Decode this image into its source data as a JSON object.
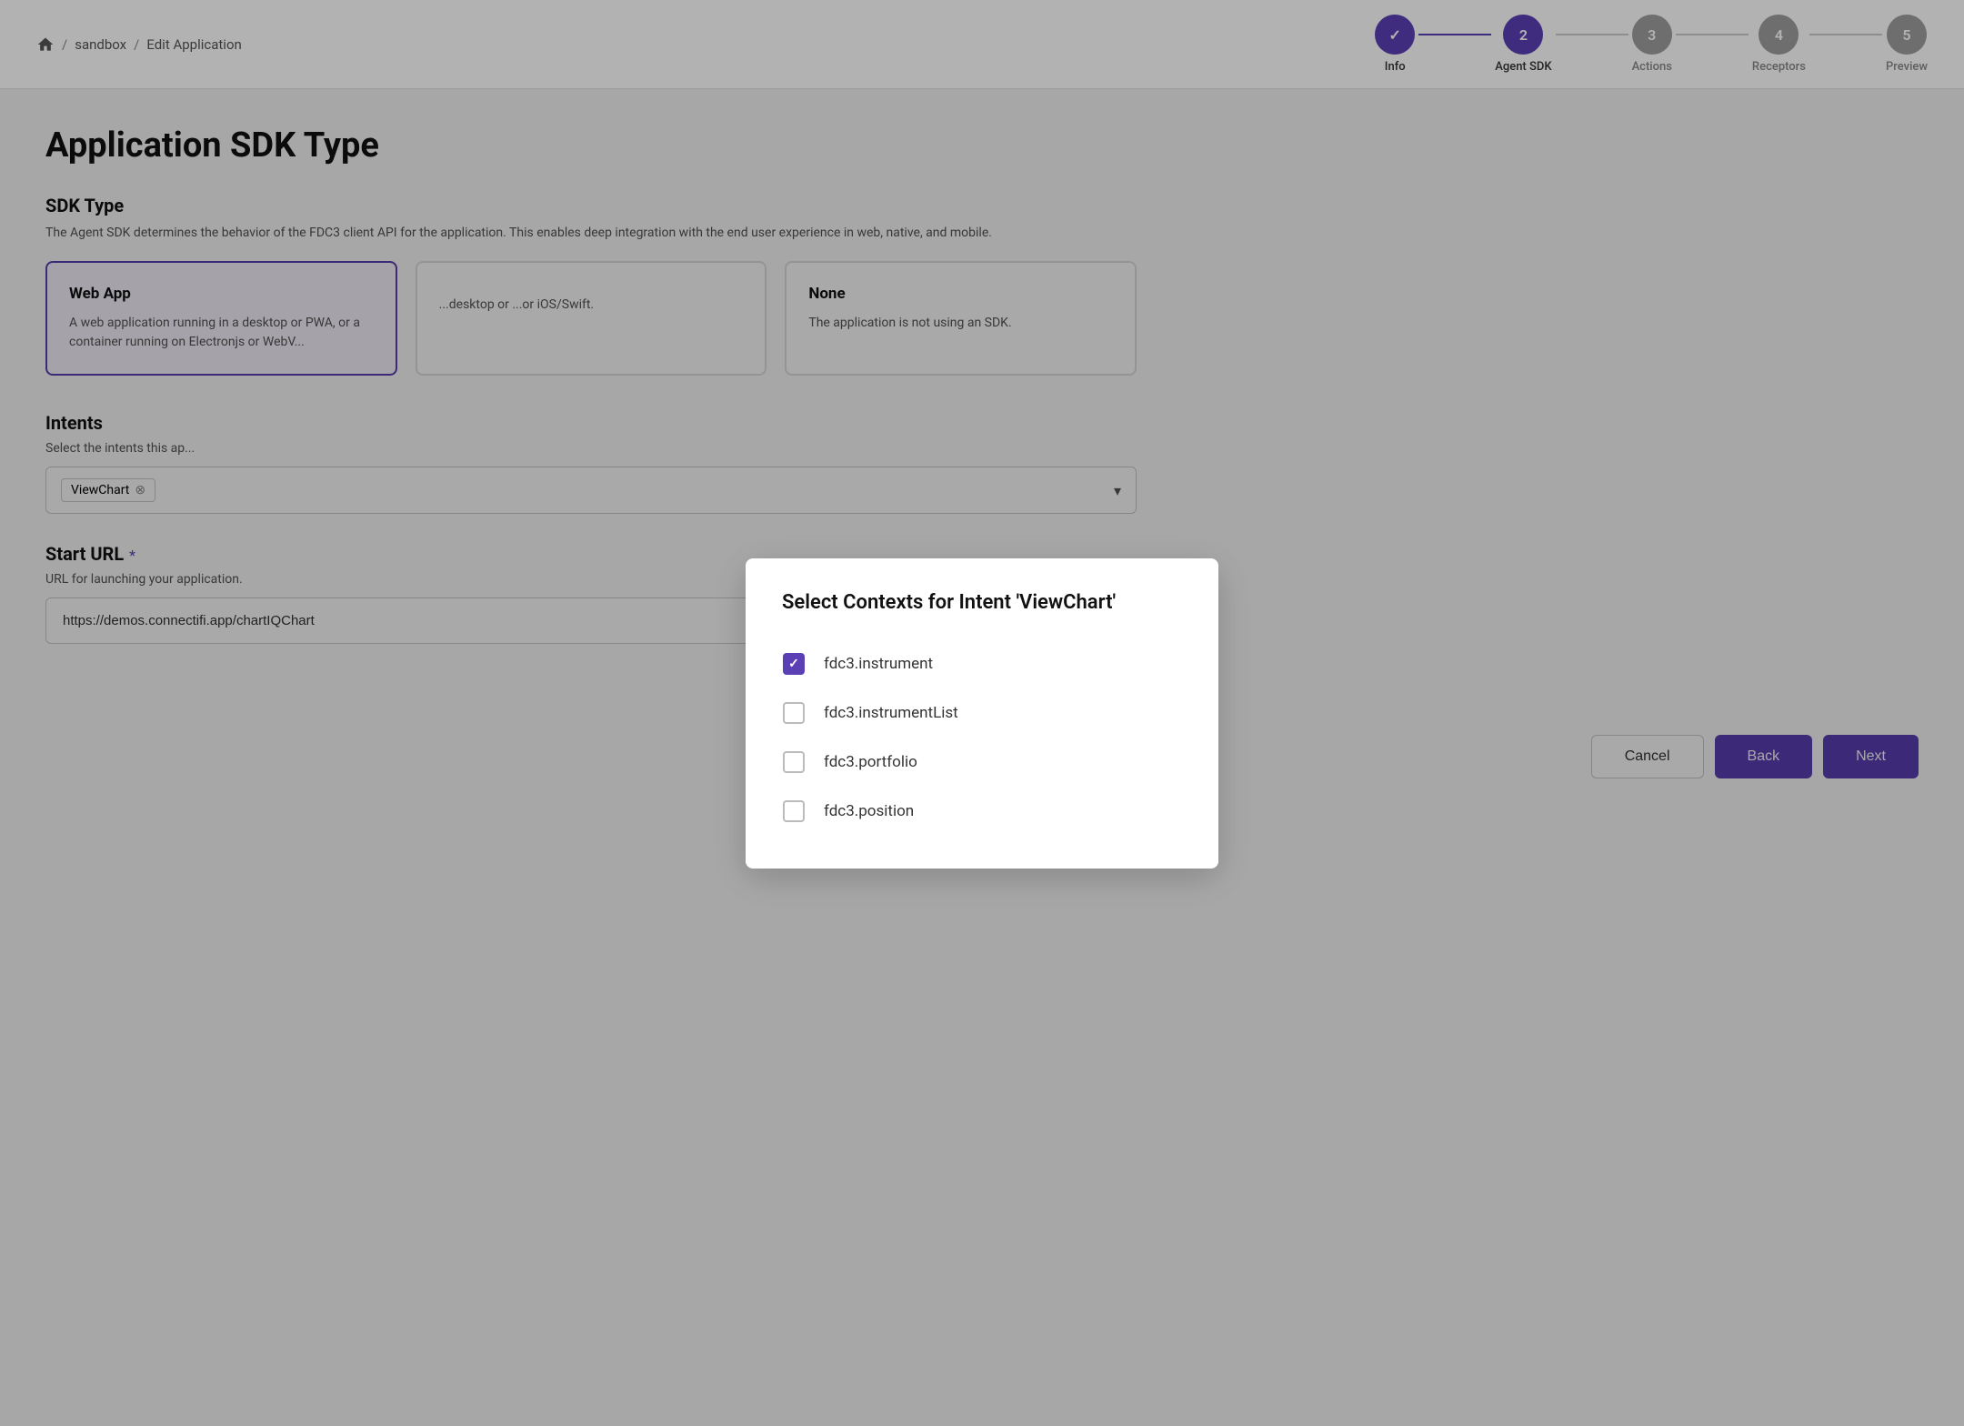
{
  "header": {
    "breadcrumb": {
      "home_icon": "🏠",
      "separator": "/",
      "sandbox": "sandbox",
      "edit": "Edit Application"
    }
  },
  "stepper": {
    "steps": [
      {
        "number": "✓",
        "label": "Info",
        "state": "completed"
      },
      {
        "number": "2",
        "label": "Agent SDK",
        "state": "active"
      },
      {
        "number": "3",
        "label": "Actions",
        "state": "inactive"
      },
      {
        "number": "4",
        "label": "Receptors",
        "state": "inactive"
      },
      {
        "number": "5",
        "label": "Preview",
        "state": "inactive"
      }
    ]
  },
  "page": {
    "title": "Application SDK Type",
    "sdk_section": {
      "title": "SDK Type",
      "description": "The Agent SDK determines the behavior of the FDC3 client API for the application. This enables deep integration with the end user experience in web, native, and mobile.",
      "cards": [
        {
          "title": "Web App",
          "description": "A web application running in a desktop or PWA, or a container running on Electronjs or WebV...",
          "selected": true
        },
        {
          "title": "",
          "description": "...desktop or ...or iOS/Swift.",
          "selected": false
        },
        {
          "title": "None",
          "description": "The application is not using an SDK.",
          "selected": false
        }
      ]
    },
    "intents_section": {
      "title": "Intents",
      "description": "Select the intents this ap...",
      "tag_label": "ViewChart",
      "dropdown_placeholder": ""
    },
    "start_url_section": {
      "title": "Start URL",
      "required": "*",
      "description": "URL for launching your application.",
      "value": "https://demos.connectifi.app/chartIQChart"
    }
  },
  "modal": {
    "title": "Select Contexts for Intent 'ViewChart'",
    "items": [
      {
        "label": "fdc3.instrument",
        "checked": true
      },
      {
        "label": "fdc3.instrumentList",
        "checked": false
      },
      {
        "label": "fdc3.portfolio",
        "checked": false
      },
      {
        "label": "fdc3.position",
        "checked": false
      }
    ]
  },
  "footer": {
    "cancel_label": "Cancel",
    "back_label": "Back",
    "next_label": "Next"
  }
}
